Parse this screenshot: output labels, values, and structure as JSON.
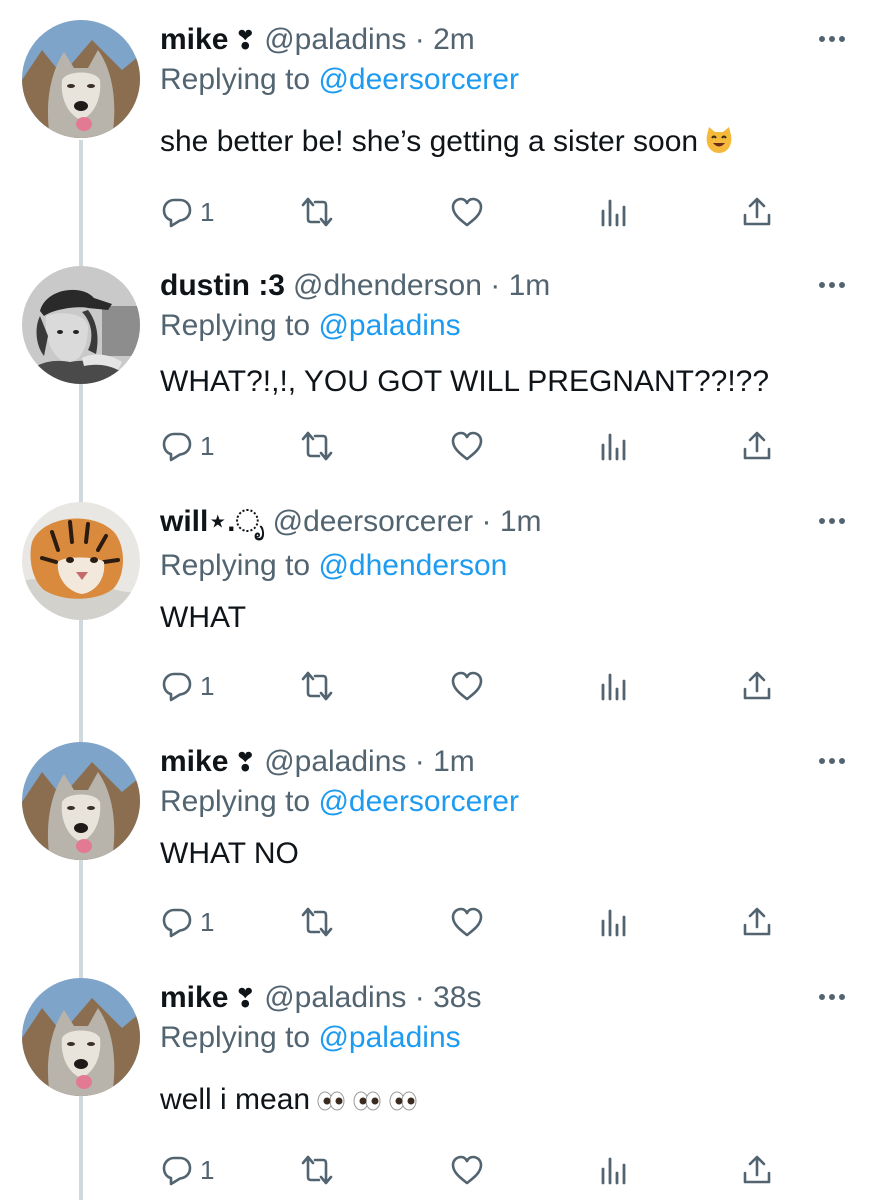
{
  "colors": {
    "link": "#1d9bf0",
    "secondary_text": "#536471",
    "primary_text": "#0f1419",
    "thread_line": "#cfd9de"
  },
  "replying_prefix": "Replying to",
  "tweets": [
    {
      "name": "mike",
      "name_emoji": "❣",
      "handle": "@paladins",
      "separator": "·",
      "time": "2m",
      "replying_to": "@deersorcerer",
      "text": "she better be! she’s getting a sister soon",
      "text_emoji": "smiling-cat-emoji",
      "reply_count": "1",
      "avatar": "wolf-avatar"
    },
    {
      "name": "dustin :3",
      "name_emoji": "",
      "handle": "@dhenderson",
      "separator": "·",
      "time": "1m",
      "replying_to": "@paladins",
      "text": "WHAT?!,!, YOU GOT WILL PREGNANT??!??",
      "text_emoji": "",
      "reply_count": "1",
      "avatar": "person-bw-avatar"
    },
    {
      "name": "will⋆.ೃ",
      "name_emoji": "",
      "handle": "@deersorcerer",
      "separator": "·",
      "time": "1m",
      "replying_to": "@dhenderson",
      "text": "WHAT",
      "text_emoji": "",
      "reply_count": "1",
      "avatar": "tiger-avatar"
    },
    {
      "name": "mike",
      "name_emoji": "❣",
      "handle": "@paladins",
      "separator": "·",
      "time": "1m",
      "replying_to": "@deersorcerer",
      "text": "WHAT NO",
      "text_emoji": "",
      "reply_count": "1",
      "avatar": "wolf-avatar"
    },
    {
      "name": "mike",
      "name_emoji": "❣",
      "handle": "@paladins",
      "separator": "·",
      "time": "38s",
      "replying_to": "@paladins",
      "text": "well i mean",
      "text_emoji": "eyes-emoji x3",
      "reply_count": "1",
      "avatar": "wolf-avatar"
    }
  ]
}
